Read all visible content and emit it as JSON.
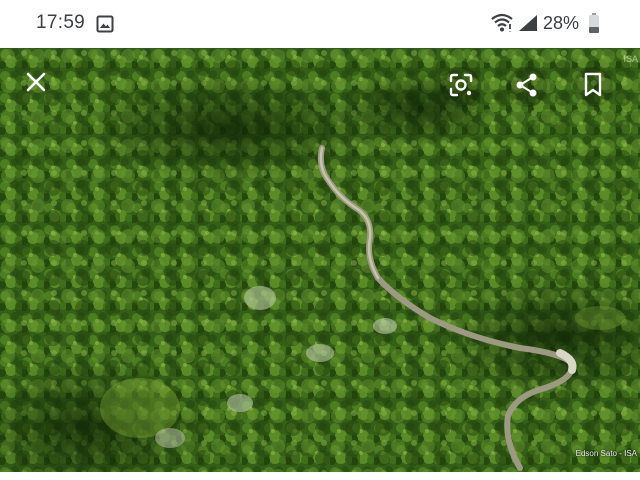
{
  "status_bar": {
    "time": "17:59",
    "battery_percent": "28%",
    "icons": [
      "gallery-icon",
      "wifi-icon",
      "signal-icon",
      "battery-icon"
    ]
  },
  "image_viewer": {
    "photo_description_icon": "aerial-forest-photo",
    "photo_credit": "Edson Sato - ISA",
    "watermark": "ISA",
    "actions": [
      {
        "name": "close",
        "icon": "close-icon"
      },
      {
        "name": "lens",
        "icon": "lens-icon"
      },
      {
        "name": "share",
        "icon": "share-icon"
      },
      {
        "name": "bookmark",
        "icon": "bookmark-icon"
      }
    ]
  },
  "colors": {
    "status_text": "#3c4043",
    "forest_dark": "#1f3d0c",
    "forest_mid": "#3f6a1c",
    "forest_light": "#6d9a2e",
    "river": "#a9a58f"
  }
}
